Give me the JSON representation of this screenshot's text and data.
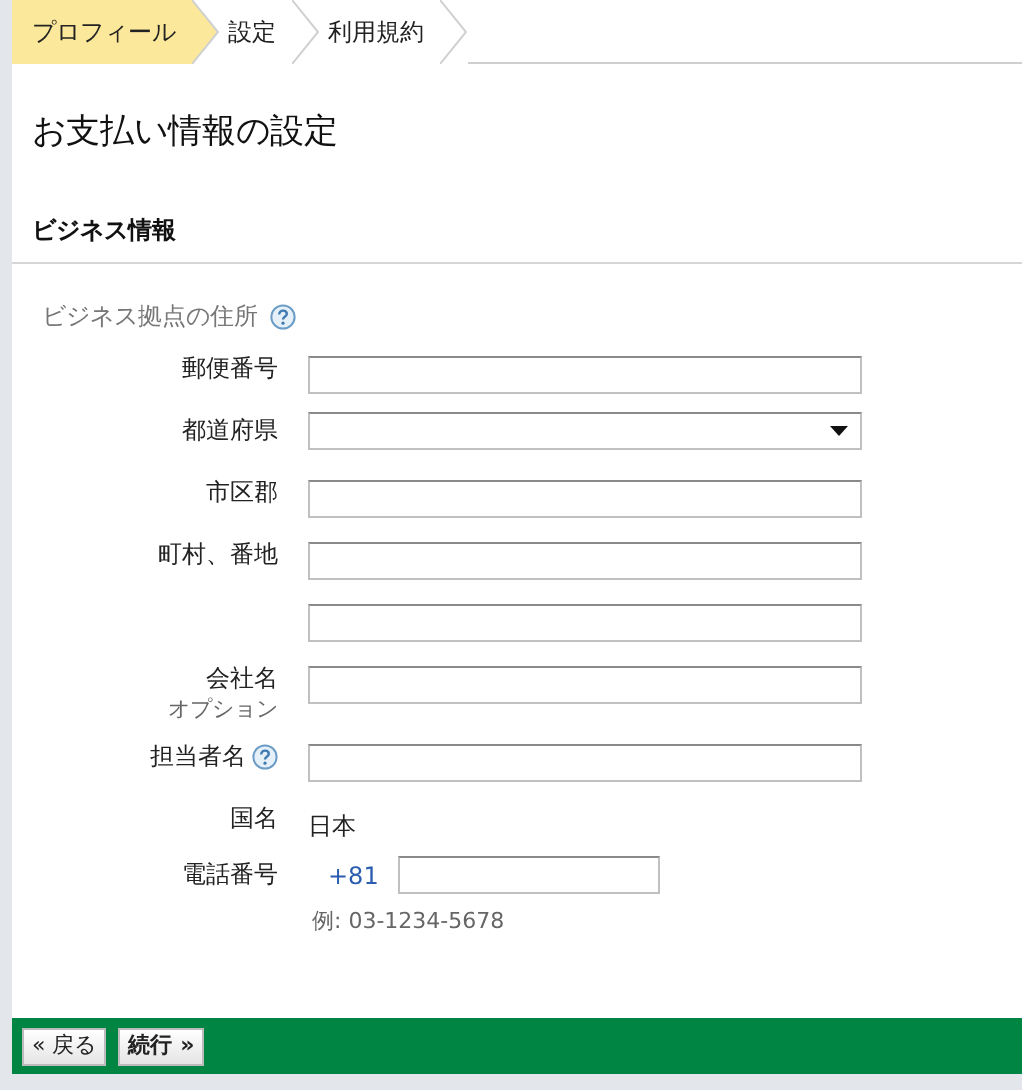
{
  "steps": [
    {
      "label": "プロフィール",
      "selected": true
    },
    {
      "label": "設定",
      "selected": false
    },
    {
      "label": "利用規約",
      "selected": false
    }
  ],
  "title": "お支払い情報の設定",
  "section": {
    "title": "ビジネス情報",
    "group_label": "ビジネス拠点の住所",
    "group_help": true
  },
  "fields": [
    {
      "kind": "text",
      "label": "郵便番号"
    },
    {
      "kind": "select",
      "label": "都道府県"
    },
    {
      "kind": "text",
      "label": "市区郡"
    },
    {
      "kind": "text",
      "label": "町村、番地"
    },
    {
      "kind": "text"
    },
    {
      "kind": "text",
      "label": "会社名",
      "note": "オプション"
    },
    {
      "kind": "text",
      "label": "担当者名",
      "help": true
    },
    {
      "kind": "static",
      "label": "国名",
      "value": "日本"
    },
    {
      "kind": "phone",
      "label": "電話番号",
      "prefix": "+81",
      "hint": "例: 03-1234-5678"
    }
  ],
  "buttons": [
    "« 戻る",
    "続行 »"
  ]
}
